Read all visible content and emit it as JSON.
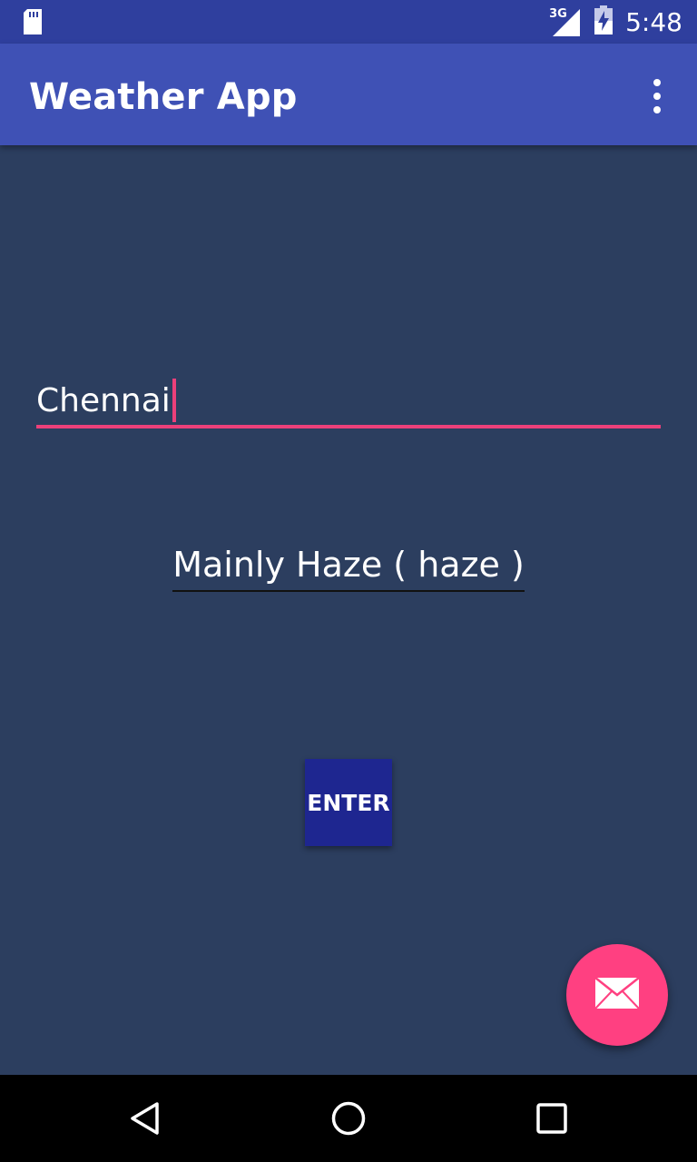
{
  "status_bar": {
    "time": "5:48",
    "network": "3G",
    "icons": [
      "sd-card-icon",
      "signal-icon",
      "battery-charging-icon"
    ]
  },
  "app_bar": {
    "title": "Weather App",
    "menu_icon": "overflow-menu-icon"
  },
  "city_input": {
    "value": "Chennai"
  },
  "weather": {
    "description": "Mainly Haze ( haze )"
  },
  "enter_button": {
    "label": "ENTER"
  },
  "fab": {
    "icon": "mail-icon"
  },
  "nav_bar": {
    "icons": [
      "back-icon",
      "home-icon",
      "recents-icon"
    ]
  },
  "colors": {
    "background": "#2c3e5f",
    "status_bar": "#2f3f9e",
    "app_bar": "#3f51b5",
    "accent": "#ff4081",
    "input_underline": "#ec407a",
    "button": "#1e2690"
  }
}
